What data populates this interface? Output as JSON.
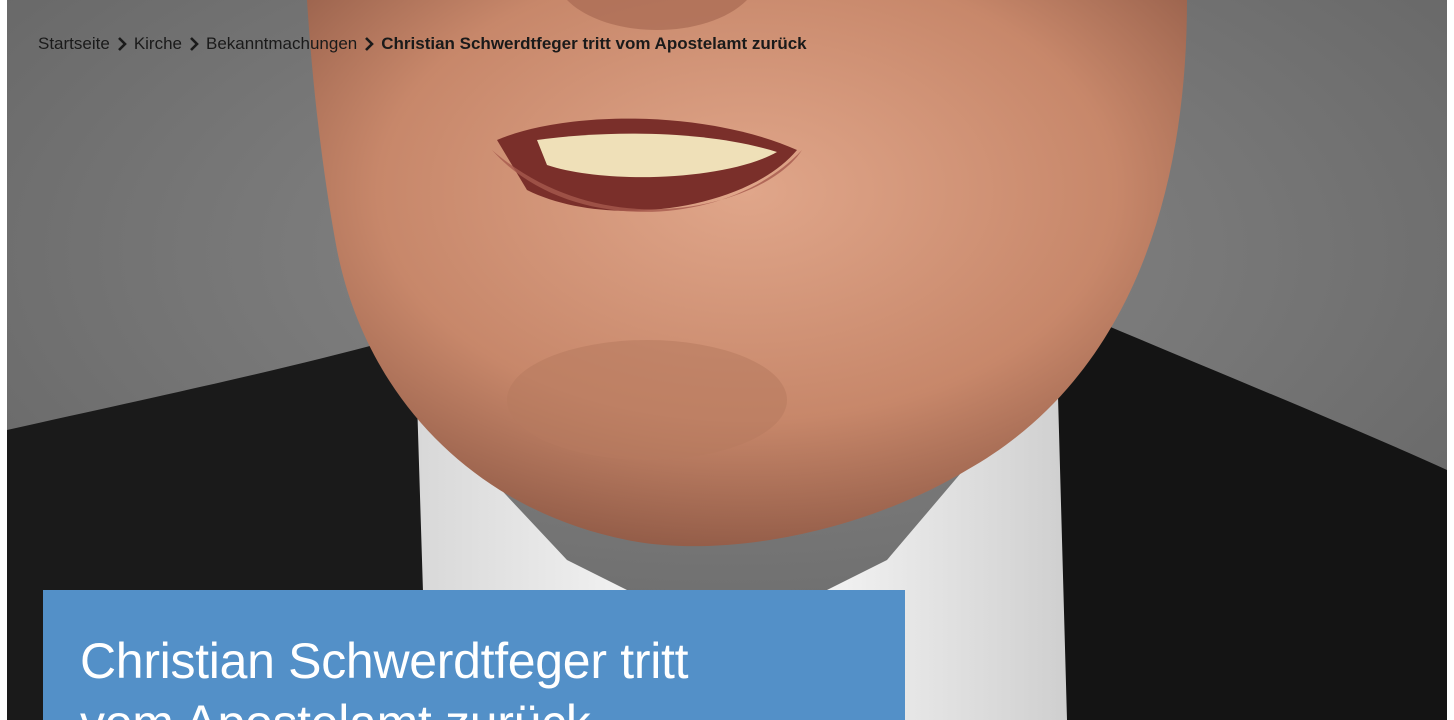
{
  "breadcrumb": {
    "items": [
      {
        "label": "Startseite"
      },
      {
        "label": "Kirche"
      },
      {
        "label": "Bekanntmachungen"
      }
    ],
    "current": "Christian Schwerdtfeger tritt vom Apostelamt zurück",
    "separator_icon": "chevron-right-icon"
  },
  "hero": {
    "image_icon": "portrait-photo"
  },
  "article": {
    "title_line1": "Christian Schwerdtfeger tritt",
    "title_line2": "vom Apostelamt zurück"
  },
  "colors": {
    "title_box": "#5390c8",
    "title_text": "#ffffff",
    "breadcrumb_text": "#1a1a1a",
    "background_grey": "#707070",
    "suit": "#151515",
    "shirt": "#f2f2f2",
    "skin": "#c98c70"
  }
}
